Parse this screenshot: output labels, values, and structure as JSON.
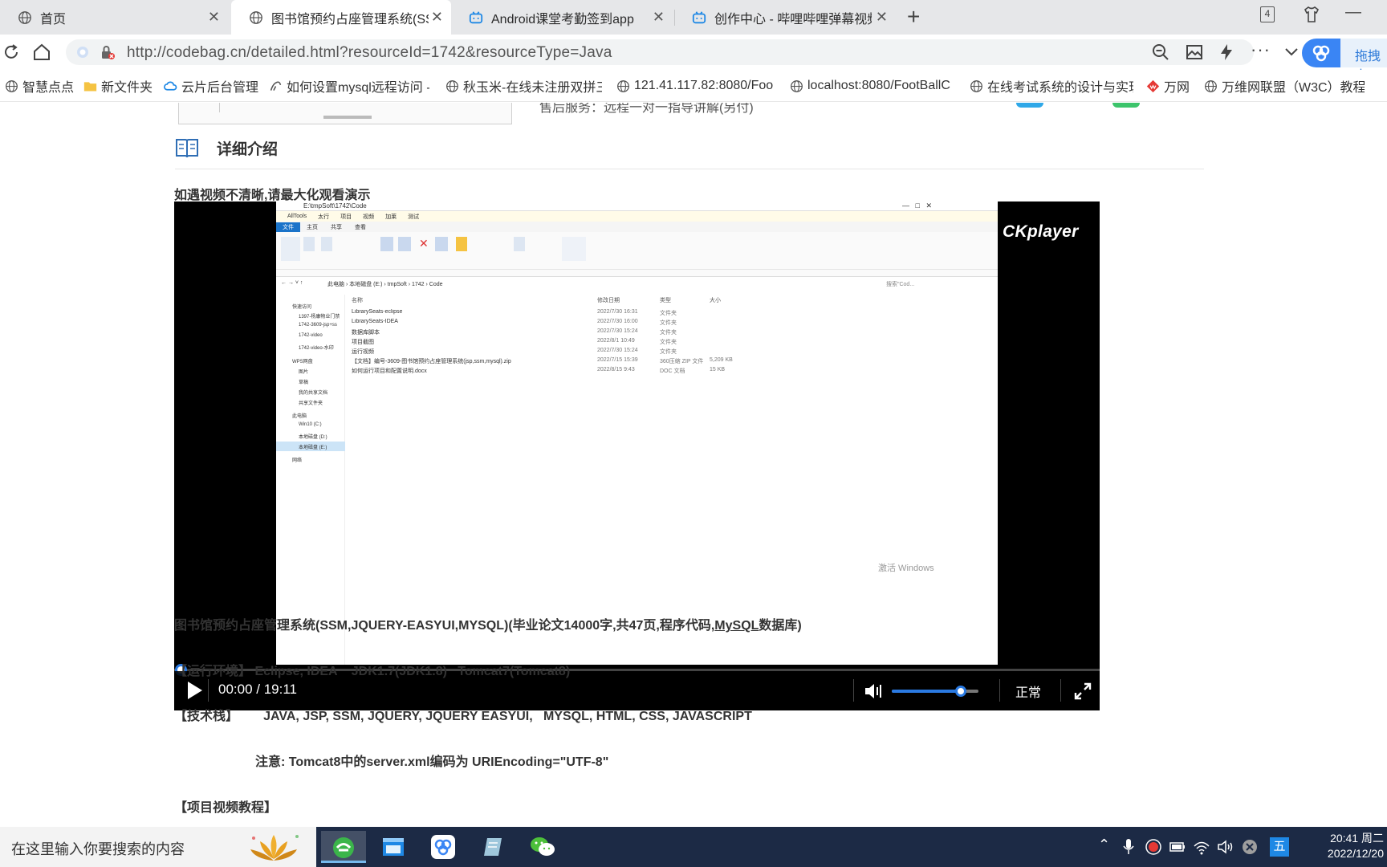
{
  "browser": {
    "tabs": [
      {
        "label": "首页",
        "active": false
      },
      {
        "label": "图书馆预约占座管理系统(SSM",
        "active": true
      },
      {
        "label": "Android课堂考勤签到app",
        "active": false
      },
      {
        "label": "创作中心 - 哔哩哔哩弹幕视频",
        "active": false
      }
    ],
    "tab_count": "4",
    "url": "http://codebag.cn/detailed.html?resourceId=1742&resourceType=Java",
    "extension_label": "拖拽上"
  },
  "bookmarks": [
    "智慧点点",
    "新文件夹",
    "云片后台管理",
    "如何设置mysql远程访问 -",
    "秋玉米-在线未注册双拼三",
    "121.41.117.82:8080/Foo",
    "localhost:8080/FootBallC",
    "在线考试系统的设计与实现",
    "万网",
    "万维网联盟（W3C）教程"
  ],
  "page": {
    "service_fragment": "售后服务：远程一对一指导讲解(另付)",
    "section_title": "详细介绍",
    "notice": "如遇视频不清晰,请最大化观看演示",
    "player": {
      "brand": "CKplayer",
      "time": "00:00 / 19:11",
      "progress": 0.0,
      "volume": 0.8,
      "rate_label": "正常"
    },
    "desc": {
      "title_prefix": "图书馆预约占座管理系统(SSM,JQUERY-EASYUI,MYSQL)(毕业论文14000字,共47页,程序代码,",
      "title_link": "MySQL",
      "title_suffix": "数据库)",
      "env": "【运行环境】 Eclipse, IDEA    JDK1.7(JDK1.8)   Tomcat7(Tomcat8)",
      "stack": "【技术栈】       JAVA, JSP, SSM, JQUERY, JQUERY EASYUI,   MYSQL, HTML, CSS, JAVASCRIPT",
      "note": "注意: Tomcat8中的server.xml编码为 URIEncoding=\"UTF-8\"",
      "video_tutorial": "【项目视频教程】"
    }
  },
  "video_frame": {
    "path_title": "E:\\tmpSoft\\1742\\Code",
    "ribbon_tabs": [
      "文件",
      "主页",
      "共享",
      "查看"
    ],
    "quick_items": [
      "AllTools",
      "太行",
      "项目",
      "视频",
      "加莱",
      "测试"
    ],
    "breadcrumb": "此电脑 › 本地磁盘 (E:) › tmpSoft › 1742 › Code",
    "search_placeholder": "搜索\"Cod...",
    "columns": [
      "名称",
      "修改日期",
      "类型",
      "大小"
    ],
    "files": [
      {
        "name": "LibrarySeats-eclipse",
        "date": "2022/7/30 16:31",
        "type": "文件夹",
        "size": ""
      },
      {
        "name": "LibrarySeats-IDEA",
        "date": "2022/7/30 16:00",
        "type": "文件夹",
        "size": ""
      },
      {
        "name": "数据库脚本",
        "date": "2022/7/30 15:24",
        "type": "文件夹",
        "size": ""
      },
      {
        "name": "项目截图",
        "date": "2022/8/1 10:49",
        "type": "文件夹",
        "size": ""
      },
      {
        "name": "运行视频",
        "date": "2022/7/30 15:24",
        "type": "文件夹",
        "size": ""
      },
      {
        "name": "【文档】编号-3609-图书馆预约占座管理系统(jsp,ssm,mysql).zip",
        "date": "2022/7/15 15:39",
        "type": "360压缩 ZIP 文件",
        "size": "5,209 KB"
      },
      {
        "name": "如何运行项目和配置说明.docx",
        "date": "2022/8/15 9:43",
        "type": "DOC 文档",
        "size": "15 KB"
      }
    ],
    "nav_tree": [
      "快速访问",
      "1397-杨康物业门禁",
      "1742-3609-jsp+ss",
      "1742-video",
      "1742-video-水印",
      "WPS网盘",
      "图片",
      "草稿",
      "我的共享文档",
      "共享文件夹",
      "此电脑",
      "Win10 (C:)",
      "本地磁盘 (D:)",
      "本地磁盘 (E:)",
      "网络"
    ],
    "watermark": "激活 Windows"
  },
  "taskbar": {
    "search_placeholder": "在这里输入你要搜索的内容",
    "ime": "五",
    "time": "20:41 周二",
    "date": "2022/12/20"
  },
  "colors": {
    "accent": "#2a7ae2",
    "tabbar_bg": "#e6e7e9",
    "taskbar_bg": "#1c2a45"
  }
}
